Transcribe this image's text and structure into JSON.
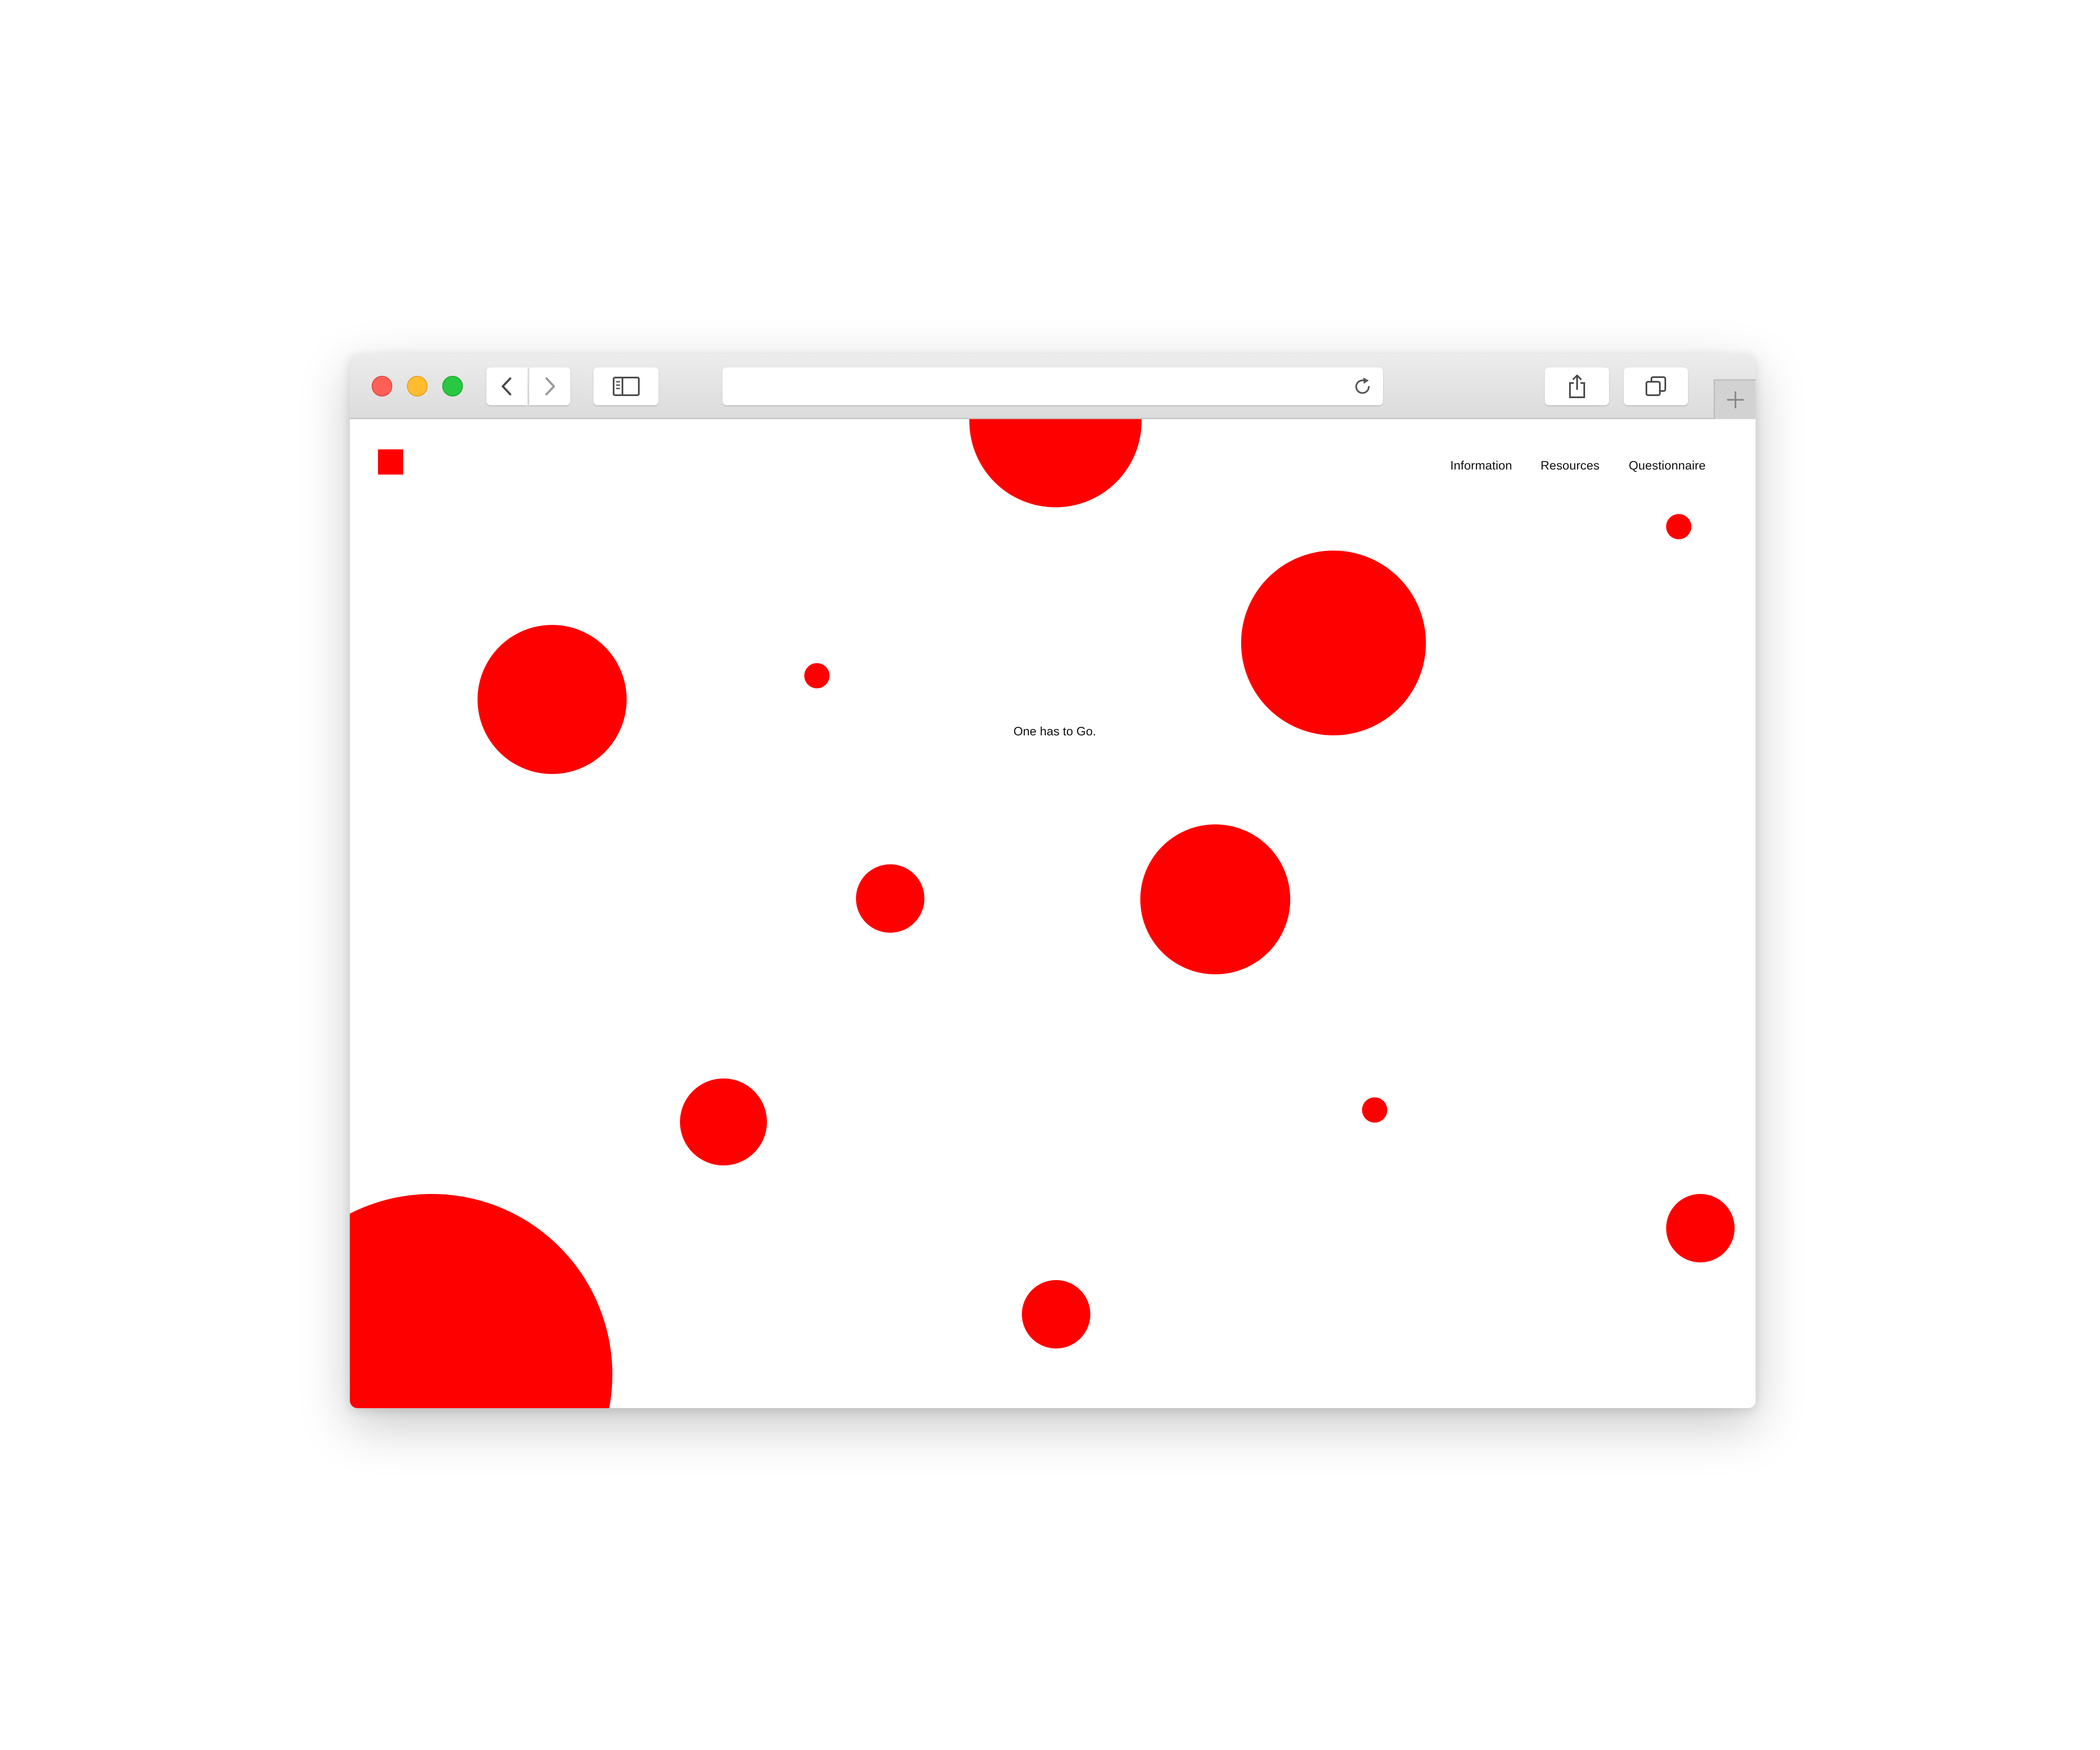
{
  "browser": {
    "address_text": "",
    "buttons": {
      "back_icon": "chevron-left-icon",
      "forward_icon": "chevron-right-icon",
      "sidebar_icon": "sidebar-icon",
      "share_icon": "share-icon",
      "tabs_icon": "tabs-overview-icon",
      "reload_icon": "reload-icon",
      "new_tab_icon": "plus-icon"
    }
  },
  "page": {
    "logo_icon": "red-square-logo",
    "nav": {
      "information": "Information",
      "resources": "Resources",
      "questionnaire": "Questionnaire"
    },
    "tagline": "One has to Go.",
    "accent_color": "#ff0000"
  }
}
